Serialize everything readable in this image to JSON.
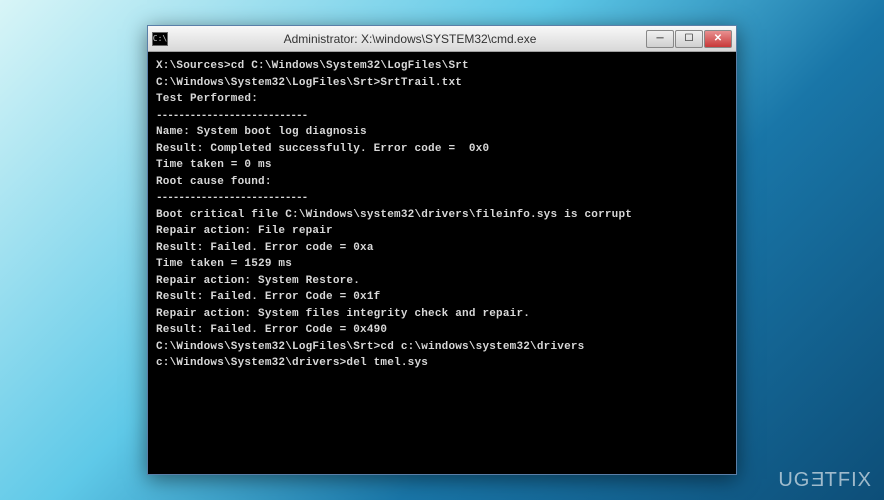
{
  "window": {
    "icon_text": "C:\\",
    "title": "Administrator: X:\\windows\\SYSTEM32\\cmd.exe",
    "buttons": {
      "minimize": "─",
      "maximize": "☐",
      "close": "✕"
    }
  },
  "terminal": {
    "lines": [
      "X:\\Sources>cd C:\\Windows\\System32\\LogFiles\\Srt",
      "",
      "C:\\Windows\\System32\\LogFiles\\Srt>SrtTrail.txt",
      "Test Performed:",
      "---------------------------",
      "Name: System boot log diagnosis",
      "Result: Completed successfully. Error code =  0x0",
      "Time taken = 0 ms",
      "",
      "Root cause found:",
      "---------------------------",
      "Boot critical file C:\\Windows\\system32\\drivers\\fileinfo.sys is corrupt",
      "",
      "Repair action: File repair",
      "Result: Failed. Error code = 0xa",
      "Time taken = 1529 ms",
      "",
      "Repair action: System Restore.",
      "Result: Failed. Error Code = 0x1f",
      "",
      "Repair action: System files integrity check and repair.",
      "Result: Failed. Error Code = 0x490",
      "",
      "C:\\Windows\\System32\\LogFiles\\Srt>cd c:\\windows\\system32\\drivers",
      "",
      "c:\\Windows\\System32\\drivers>del tmel.sys"
    ]
  },
  "watermark": {
    "text_before": "UG",
    "text_e": "E",
    "text_after": "TFIX"
  }
}
